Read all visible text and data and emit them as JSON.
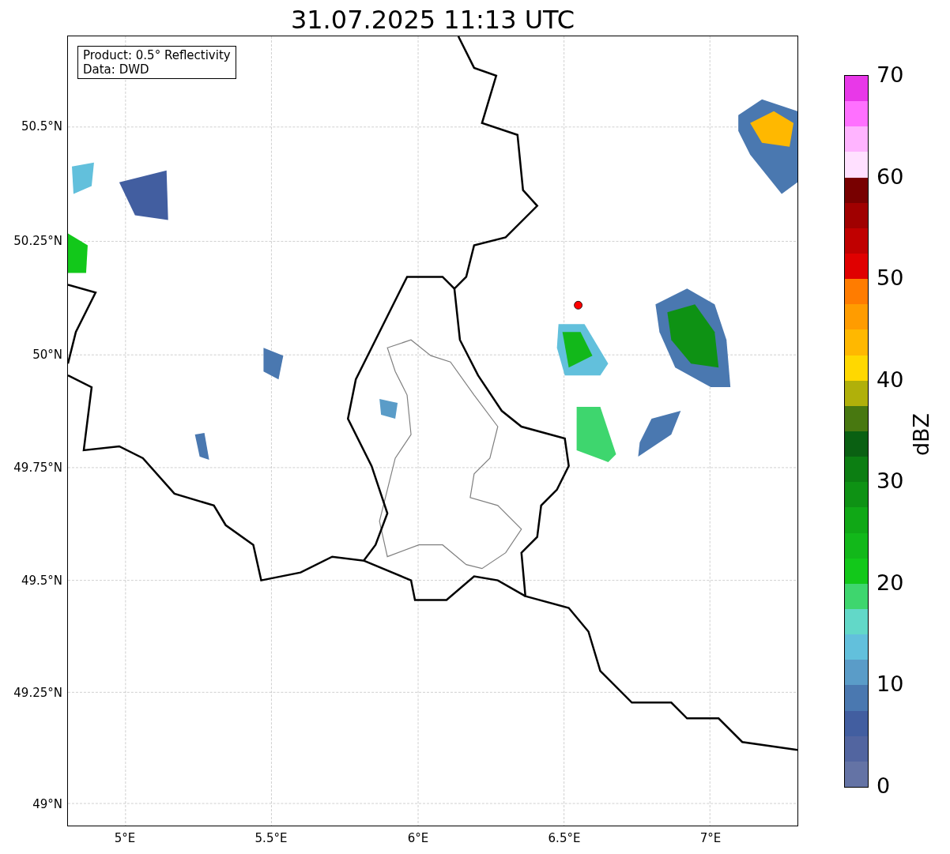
{
  "title": "31.07.2025 11:13 UTC",
  "legend": [
    "Product: 0.5° Reflectivity",
    "Data: DWD"
  ],
  "y_ticks": [
    "50.5°N",
    "50.25°N",
    "50°N",
    "49.75°N",
    "49.5°N",
    "49.25°N",
    "49°N"
  ],
  "x_ticks": [
    "5°E",
    "5.5°E",
    "6°E",
    "6.5°E",
    "7°E"
  ],
  "colorbar": {
    "label": "dBZ",
    "ticks": [
      "70",
      "60",
      "50",
      "40",
      "30",
      "20",
      "10",
      "0"
    ],
    "segments": [
      {
        "color": "#6473a5"
      },
      {
        "color": "#5265a0"
      },
      {
        "color": "#425ea0"
      },
      {
        "color": "#4a78b0"
      },
      {
        "color": "#5a9cc8"
      },
      {
        "color": "#62c0dc"
      },
      {
        "color": "#62d8c8"
      },
      {
        "color": "#3ed66e"
      },
      {
        "color": "#12c81a"
      },
      {
        "color": "#12b81a"
      },
      {
        "color": "#10a816"
      },
      {
        "color": "#0e9214"
      },
      {
        "color": "#0c7e12"
      },
      {
        "color": "#0a6012"
      },
      {
        "color": "#487810"
      },
      {
        "color": "#b0b00a"
      },
      {
        "color": "#ffd800"
      },
      {
        "color": "#ffb800"
      },
      {
        "color": "#ff9c00"
      },
      {
        "color": "#ff7c00"
      },
      {
        "color": "#e00000"
      },
      {
        "color": "#c00000"
      },
      {
        "color": "#a00000"
      },
      {
        "color": "#780000"
      },
      {
        "color": "#ffe0ff"
      },
      {
        "color": "#ffb4ff"
      },
      {
        "color": "#ff70ff"
      },
      {
        "color": "#e838e8"
      }
    ]
  }
}
